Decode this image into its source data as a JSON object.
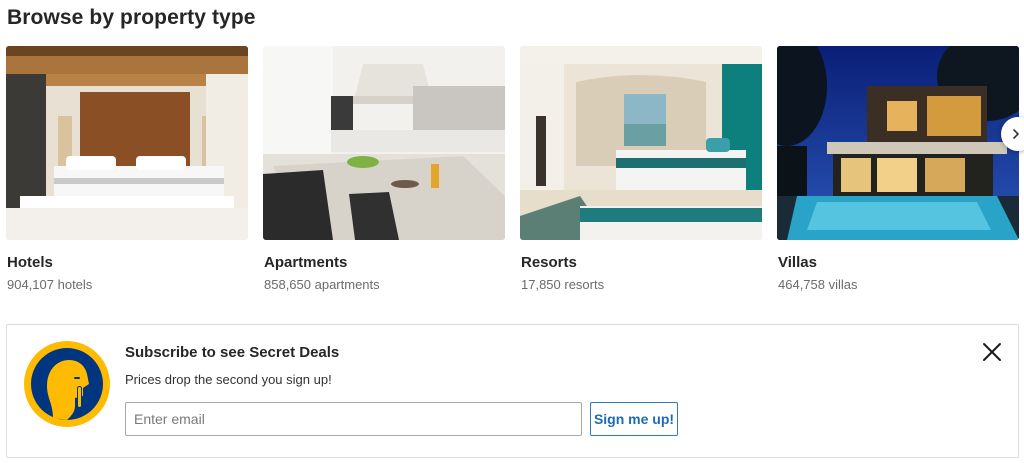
{
  "section": {
    "title": "Browse by property type"
  },
  "property_types": [
    {
      "name": "Hotels",
      "count": "904,107 hotels"
    },
    {
      "name": "Apartments",
      "count": "858,650 apartments"
    },
    {
      "name": "Resorts",
      "count": "17,850 resorts"
    },
    {
      "name": "Villas",
      "count": "464,758 villas"
    }
  ],
  "carousel": {
    "next_icon": "chevron-right-icon"
  },
  "subscribe": {
    "headline": "Subscribe to see Secret Deals",
    "subline": "Prices drop the second you sign up!",
    "email_placeholder": "Enter email",
    "email_value": "",
    "button_label": "Sign me up!",
    "close_icon": "close-icon",
    "logo_icon": "secret-deals-icon"
  },
  "colors": {
    "brand_blue": "#003580",
    "brand_yellow": "#febb02",
    "link_blue": "#0071c2"
  }
}
